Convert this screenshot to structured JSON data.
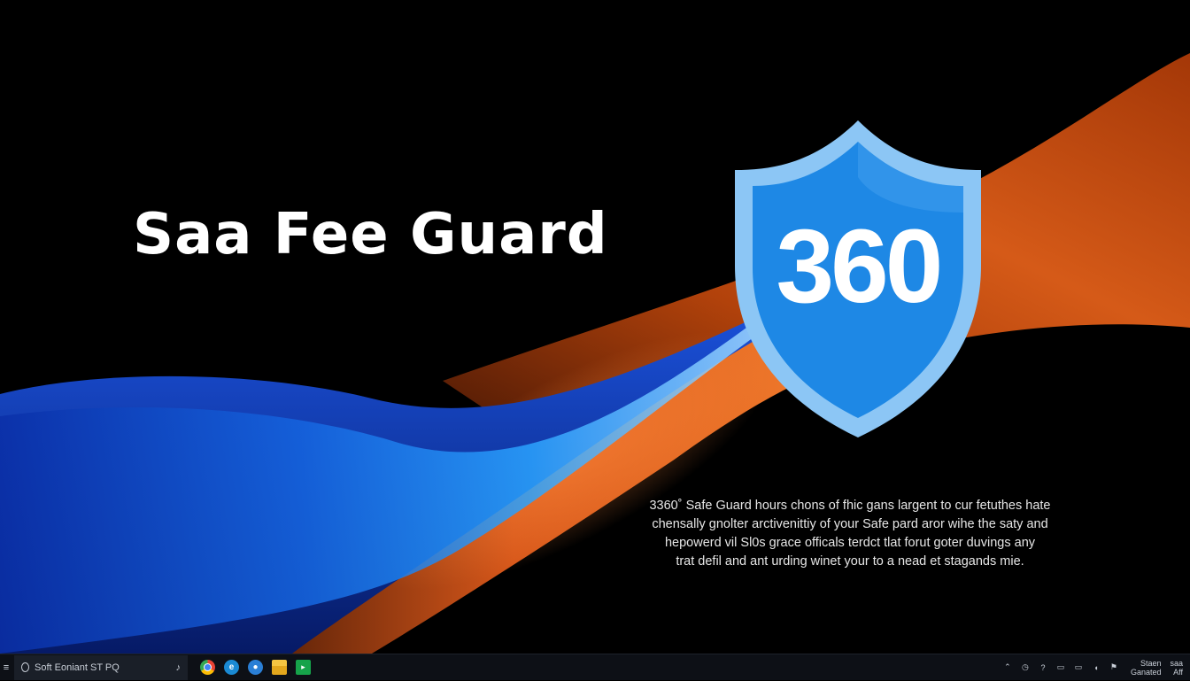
{
  "desktop": {
    "headline": "Saa Fee Guard",
    "shield_text": "360",
    "description_lines": [
      "3360˚ Safe Guard hours chons of fhic gans largent to cur fetuthes hate",
      "chensally gnolter arctivenittiy of your Safe pard aror wihe the saty and",
      "hepowerd vil Sl0s grace officals terdct tlat forut goter duvings any",
      "trat defil and ant urding winet your to a nead et stagands mie."
    ],
    "colors": {
      "background": "#000000",
      "shield_fill": "#1e88e5",
      "shield_border": "#90caf9",
      "wave_blue": "#1e6fe0",
      "wave_orange": "#e0560f"
    }
  },
  "taskbar": {
    "search_text": "Soft Eoniant ST PQ",
    "start_glyph": "≡",
    "tray_glyphs": [
      "⌃",
      "◷",
      "?",
      "▭",
      "▭",
      "◖",
      "⚑"
    ],
    "clock_lines": [
      "Staen",
      "Ganated"
    ],
    "clock_right_lines": [
      "saa",
      "Aff"
    ],
    "icons": [
      "start-icon",
      "search-icon",
      "mic-icon",
      "chrome-icon",
      "edge-icon",
      "settings-icon",
      "folder-icon",
      "store-icon"
    ]
  }
}
